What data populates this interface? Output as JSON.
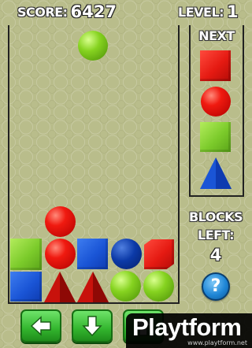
{
  "hud": {
    "score_label": "SCORE:",
    "score_value": "6427",
    "level_label": "LEVEL:",
    "level_value": "1"
  },
  "next_panel": {
    "title": "NEXT",
    "queue": [
      "red-cube",
      "red-ball",
      "green-cube",
      "blue-pyramid"
    ]
  },
  "falling_piece": "green-ball",
  "board": {
    "rows_bottom_up": [
      [
        "blue-cube",
        "red-pyramid",
        "red-pyramid",
        "green-ball",
        "green-ball"
      ],
      [
        "green-cube",
        "red-ball",
        "blue-cube",
        "blue-ball",
        "red-cube"
      ],
      [
        "",
        "red-ball",
        "",
        "",
        ""
      ]
    ]
  },
  "blocks_left": {
    "label_line1": "BLOCKS",
    "label_line2": "LEFT:",
    "value": "4"
  },
  "help_button": {
    "label": "?"
  },
  "controls": {
    "left": "left-arrow-icon",
    "down": "down-arrow-icon",
    "rotate": "rotate-icon"
  },
  "watermark": {
    "title": "Playtform",
    "url": "www.playtform.net"
  },
  "colors": {
    "red": "#e51a12",
    "green": "#7ccb2b",
    "blue": "#1a55d6",
    "button_green": "#33b52e"
  }
}
